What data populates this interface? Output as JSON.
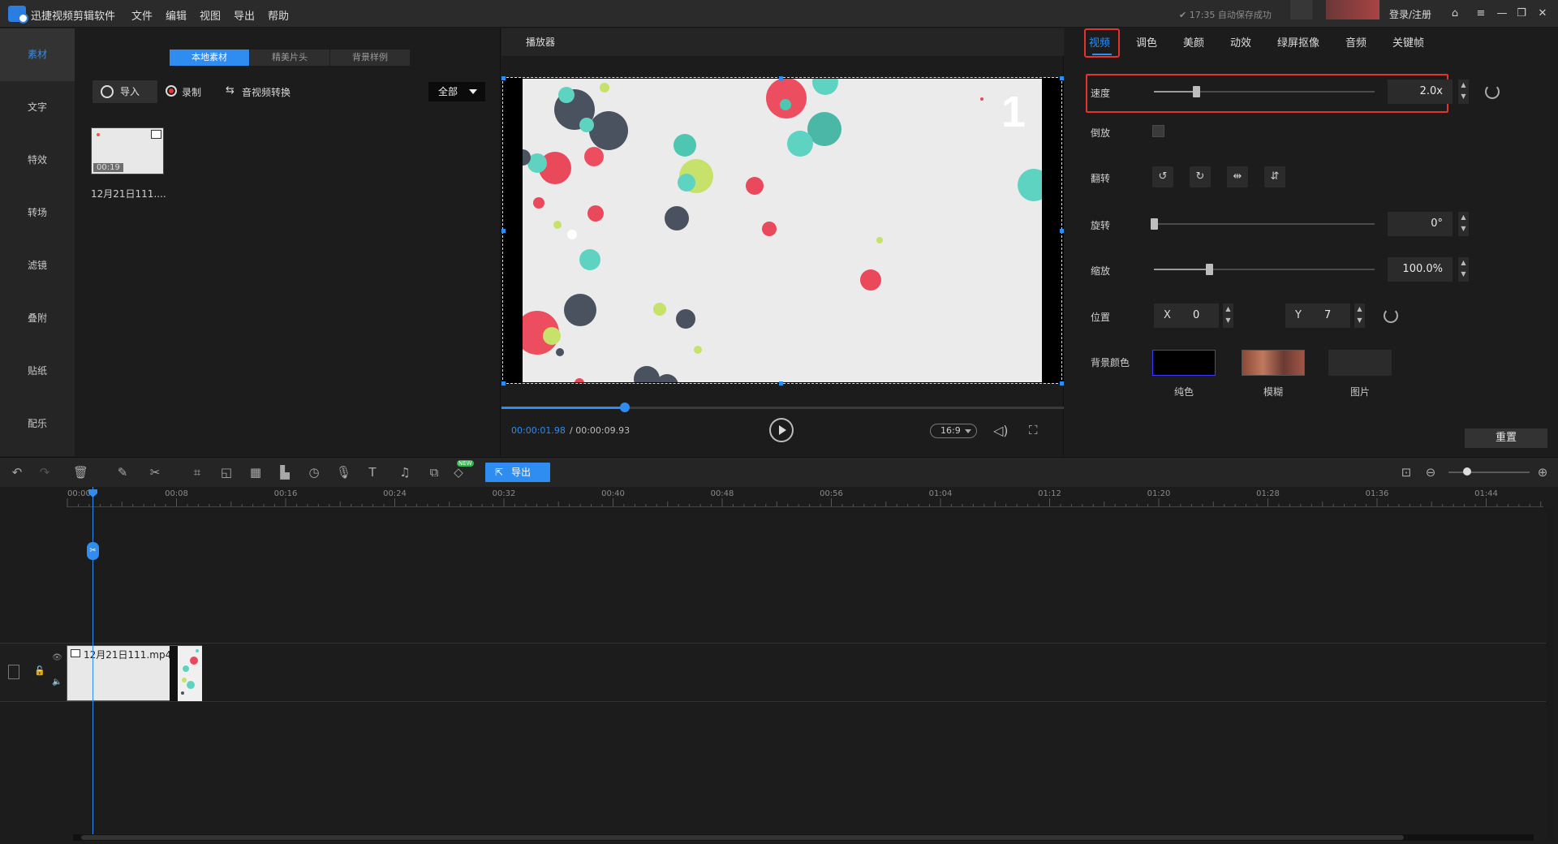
{
  "app": {
    "title": "迅捷视频剪辑软件"
  },
  "menu": [
    "文件",
    "编辑",
    "视图",
    "导出",
    "帮助"
  ],
  "header": {
    "save_status": "✔ 17:35 自动保存成功",
    "login": "登录/注册"
  },
  "sidebar": {
    "items": [
      "素材",
      "文字",
      "特效",
      "转场",
      "滤镜",
      "叠附",
      "贴纸",
      "配乐"
    ]
  },
  "media": {
    "tabs": [
      "本地素材",
      "精美片头",
      "背景样例"
    ],
    "import_label": "导入",
    "record_label": "录制",
    "convert_label": "音视频转换",
    "filter_value": "全部",
    "clip": {
      "duration": "00:19",
      "name": "12月21日111...."
    }
  },
  "player": {
    "label": "播放器",
    "frame_number": "1",
    "progress_fraction": 0.22,
    "time_current": "00:00:01.98",
    "time_total": "/ 00:00:09.93",
    "aspect_ratio": "16:9"
  },
  "props": {
    "tabs": [
      "视频",
      "调色",
      "美颜",
      "动效",
      "绿屏抠像",
      "音频",
      "关键帧"
    ],
    "speed": {
      "label": "速度",
      "value": "2.0x",
      "fraction": 0.19
    },
    "reverse": {
      "label": "倒放"
    },
    "flip": {
      "label": "翻转"
    },
    "rotate": {
      "label": "旋转",
      "value": "0°",
      "fraction": 0.0
    },
    "scale": {
      "label": "缩放",
      "value": "100.0%",
      "fraction": 0.25
    },
    "position": {
      "label": "位置",
      "x_axis": "X",
      "x": "0",
      "y_axis": "Y",
      "y": "7"
    },
    "background": {
      "label": "背景颜色",
      "options": [
        "纯色",
        "模糊",
        "图片"
      ]
    },
    "reset_label": "重置"
  },
  "timeline": {
    "export_label": "导出",
    "new_badge": "NEW",
    "ticks": [
      "00:00",
      "00:08",
      "00:16",
      "00:24",
      "00:32",
      "00:40",
      "00:48",
      "00:56",
      "01:04",
      "01:12",
      "01:20",
      "01:28",
      "01:36",
      "01:44"
    ],
    "clip_name": "12月21日111.mp4",
    "zoom_fraction": 0.23
  },
  "colors": {
    "accent": "#2f8cf0",
    "highlight": "#e2342d"
  }
}
